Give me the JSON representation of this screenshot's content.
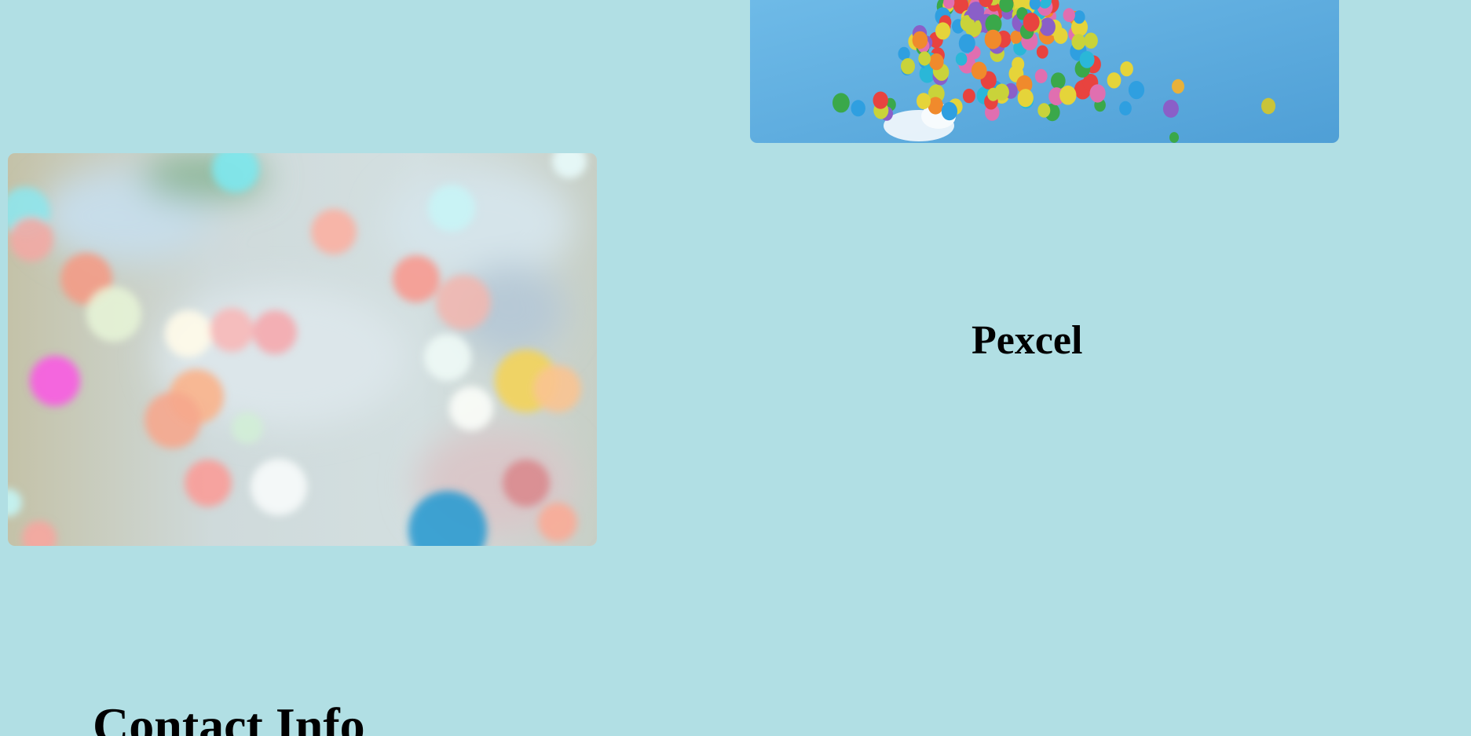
{
  "gallery": {
    "caption": "Pexcel",
    "images": [
      {
        "name": "balloons-photo",
        "sky_color": "#5aaee0"
      },
      {
        "name": "bokeh-lights-photo",
        "base_color": "#c9d6d6"
      }
    ]
  },
  "contact": {
    "heading": "Contact Info"
  },
  "theme": {
    "background": "#b1dfe4",
    "text": "#000000"
  }
}
